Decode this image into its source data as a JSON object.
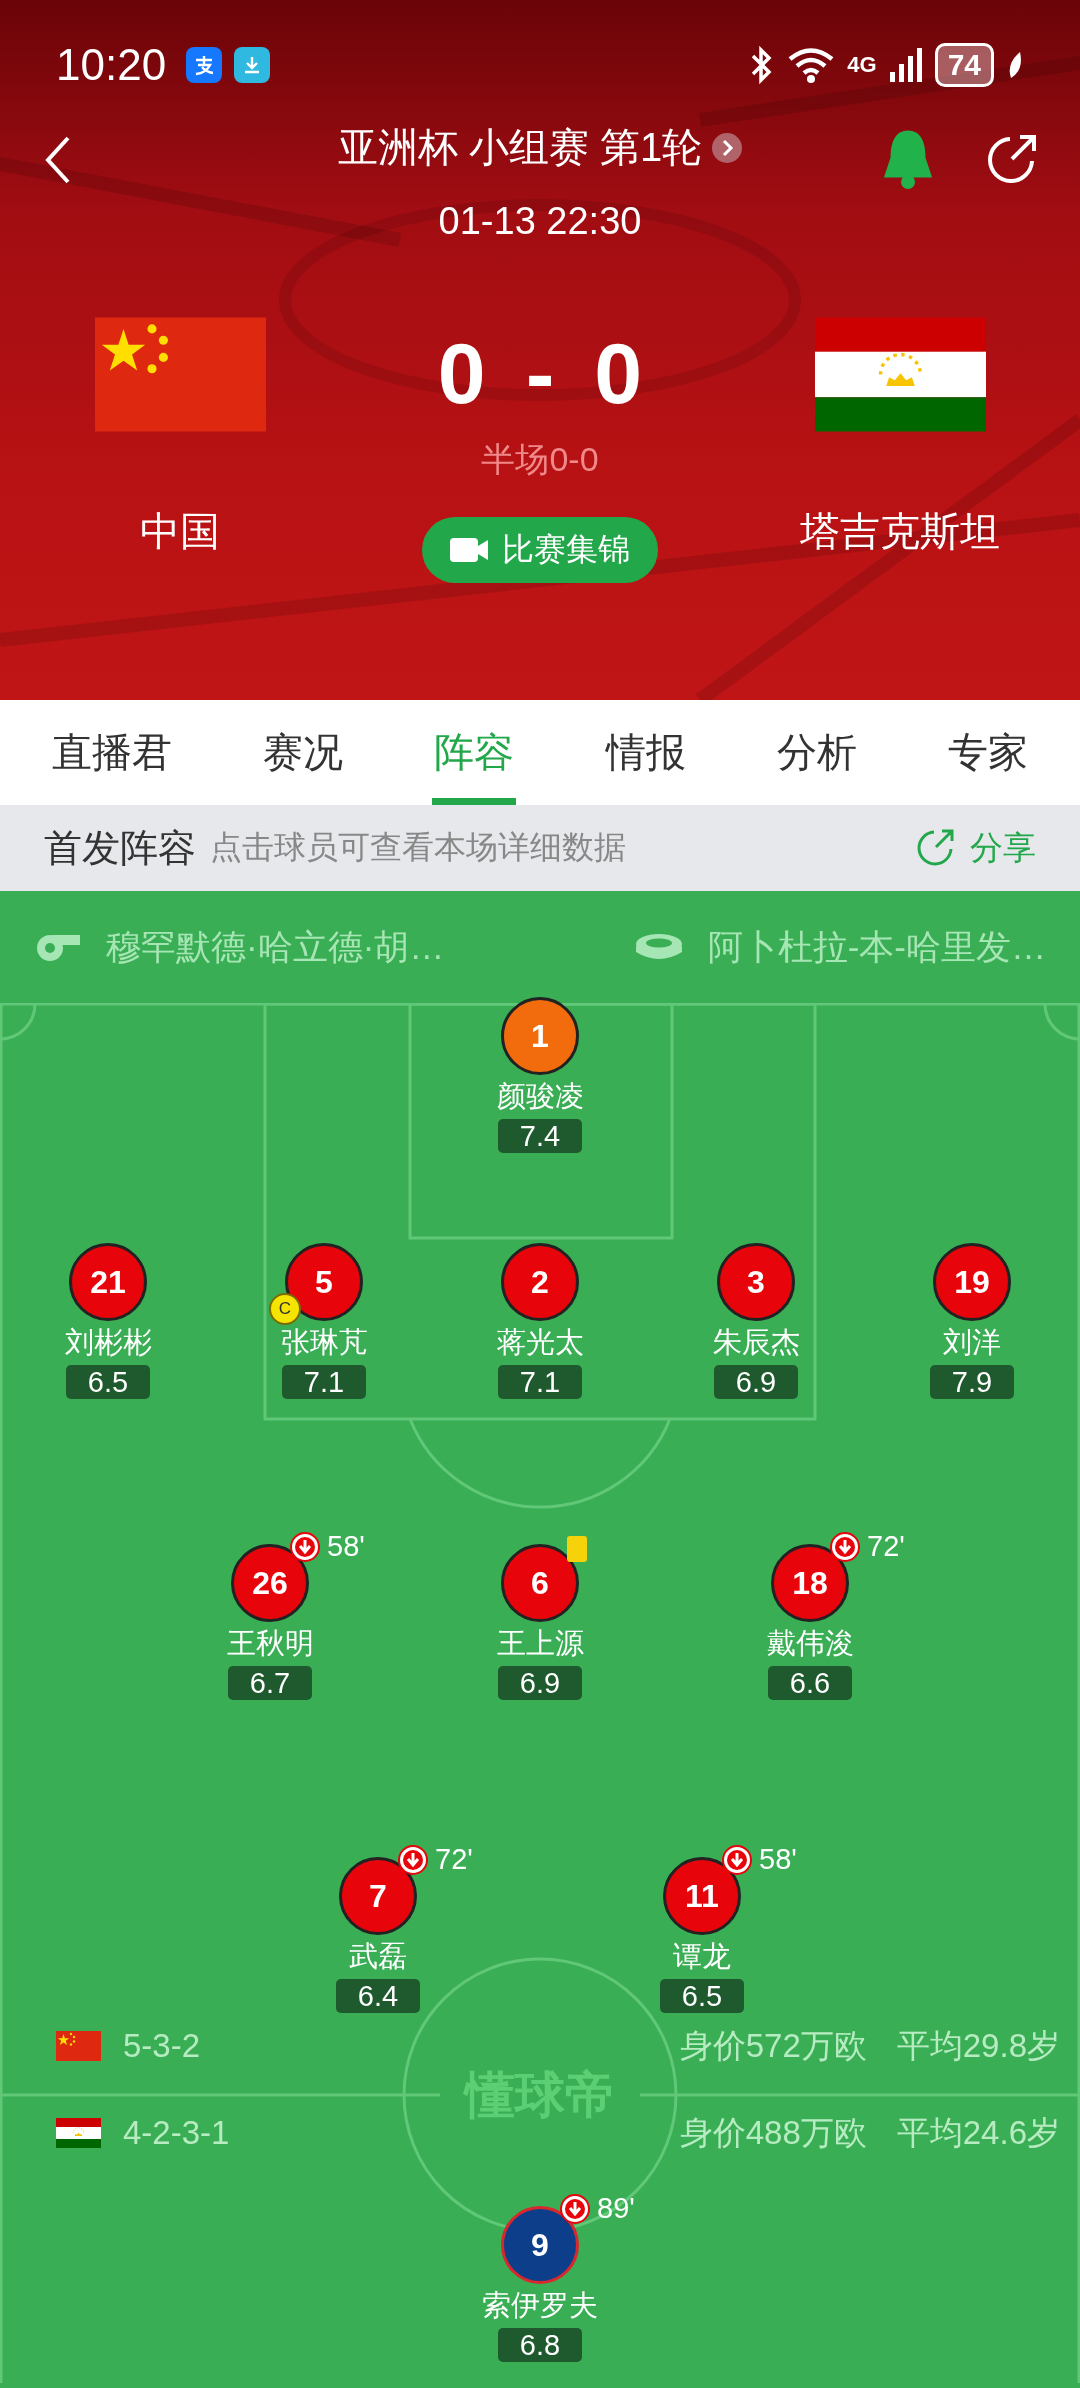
{
  "status_bar": {
    "time": "10:20",
    "network": "4G",
    "battery": "74"
  },
  "header": {
    "competition": "亚洲杯 小组赛 第1轮",
    "datetime": "01-13 22:30",
    "notify_on": true
  },
  "match": {
    "home": {
      "name": "中国"
    },
    "away": {
      "name": "塔吉克斯坦"
    },
    "home_score": "0",
    "separator": "-",
    "away_score": "0",
    "half_time": "半场0-0",
    "highlights_button": "比赛集锦"
  },
  "tabs": [
    {
      "label": "直播君",
      "selected": false
    },
    {
      "label": "赛况",
      "selected": false
    },
    {
      "label": "阵容",
      "selected": true
    },
    {
      "label": "情报",
      "selected": false
    },
    {
      "label": "分析",
      "selected": false
    },
    {
      "label": "专家",
      "selected": false
    }
  ],
  "section": {
    "title": "首发阵容",
    "hint": "点击球员可查看本场详细数据",
    "share": "分享"
  },
  "info": {
    "referee": "穆罕默德·哈立德·胡…",
    "venue": "阿卜杜拉-本-哈里发…"
  },
  "home_lineup": {
    "lines": [
      [
        {
          "number": "1",
          "name": "颜骏凌",
          "rating": "7.4",
          "kind": "goalkeeper",
          "yellow_card": false,
          "substituted": false
        }
      ],
      [
        {
          "number": "21",
          "name": "刘彬彬",
          "rating": "6.5",
          "kind": "outfield",
          "yellow_card": false,
          "substituted": false
        },
        {
          "number": "5",
          "name": "张琳芃",
          "rating": "7.1",
          "kind": "outfield",
          "captain": "C",
          "yellow_card": false,
          "substituted": false
        },
        {
          "number": "2",
          "name": "蒋光太",
          "rating": "7.1",
          "kind": "outfield",
          "yellow_card": false,
          "substituted": false
        },
        {
          "number": "3",
          "name": "朱辰杰",
          "rating": "6.9",
          "kind": "outfield",
          "yellow_card": false,
          "substituted": false
        },
        {
          "number": "19",
          "name": "刘洋",
          "rating": "7.9",
          "kind": "outfield",
          "yellow_card": false,
          "substituted": false
        }
      ],
      [
        {
          "number": "26",
          "name": "王秋明",
          "rating": "6.7",
          "kind": "outfield",
          "yellow_card": false,
          "substituted": true,
          "sub_minute": "58'"
        },
        {
          "number": "6",
          "name": "王上源",
          "rating": "6.9",
          "kind": "outfield",
          "yellow_card": true,
          "substituted": false
        },
        {
          "number": "18",
          "name": "戴伟浚",
          "rating": "6.6",
          "kind": "outfield",
          "yellow_card": false,
          "substituted": true,
          "sub_minute": "72'"
        }
      ],
      [
        {
          "number": "7",
          "name": "武磊",
          "rating": "6.4",
          "kind": "outfield",
          "yellow_card": false,
          "substituted": true,
          "sub_minute": "72'"
        },
        {
          "number": "11",
          "name": "谭龙",
          "rating": "6.5",
          "kind": "outfield",
          "yellow_card": false,
          "substituted": true,
          "sub_minute": "58'"
        }
      ]
    ]
  },
  "formations": [
    {
      "formation": "5-3-2",
      "value": "身价572万欧",
      "average_age": "平均29.8岁"
    },
    {
      "formation": "4-2-3-1",
      "value": "身价488万欧",
      "average_age": "平均24.6岁"
    }
  ],
  "pitch_logo": "懂球帝",
  "away_lineup": {
    "lines": [
      [
        {
          "number": "9",
          "name": "索伊罗夫",
          "rating": "6.8",
          "kind": "away",
          "yellow_card": false,
          "substituted": true,
          "sub_minute": "89'"
        }
      ]
    ]
  }
}
